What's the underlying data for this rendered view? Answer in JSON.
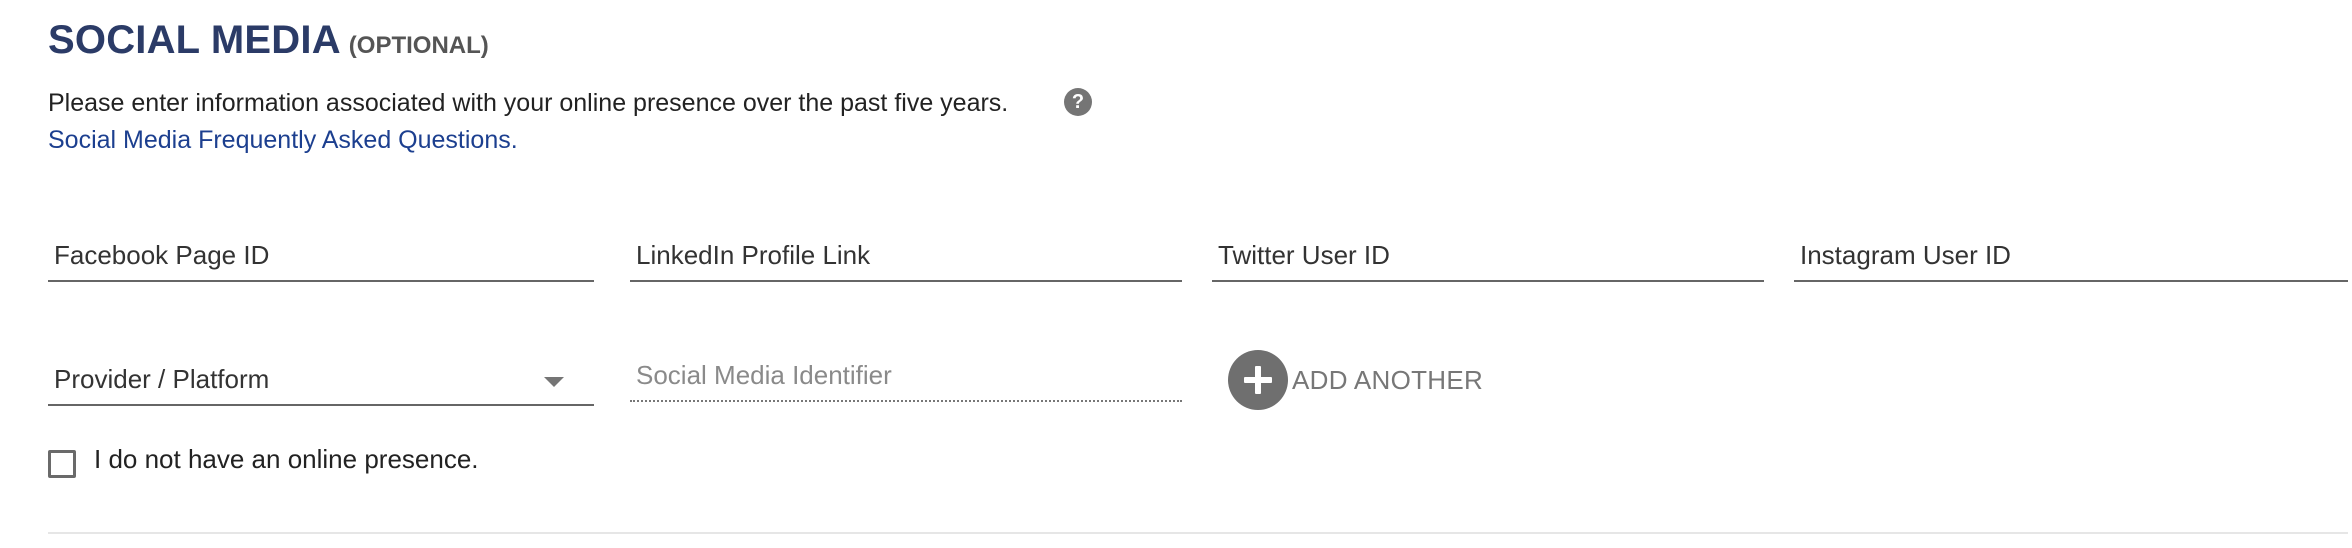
{
  "section": {
    "title": "SOCIAL MEDIA",
    "optional_tag": "(OPTIONAL)",
    "description": "Please enter information associated with your online presence over the past five years.",
    "help_icon": "question-circle-icon",
    "faq_link": "Social Media Frequently Asked Questions",
    "faq_period": "."
  },
  "fields": {
    "facebook": {
      "label": "Facebook Page ID",
      "value": ""
    },
    "linkedin": {
      "label": "LinkedIn Profile Link",
      "value": ""
    },
    "twitter": {
      "label": "Twitter User ID",
      "value": ""
    },
    "instagram": {
      "label": "Instagram User ID",
      "value": ""
    }
  },
  "provider_select": {
    "selected": "Provider / Platform",
    "icon": "caret-down-icon"
  },
  "identifier_input": {
    "placeholder": "Social Media Identifier",
    "value": ""
  },
  "add_another": {
    "label": "ADD ANOTHER",
    "icon": "plus-circle-icon"
  },
  "no_presence": {
    "label": "I do not have an online presence.",
    "checked": false
  },
  "colors": {
    "title": "#2b3b67",
    "link": "#1c3f8f",
    "icon_gray": "#6f6f6f"
  }
}
